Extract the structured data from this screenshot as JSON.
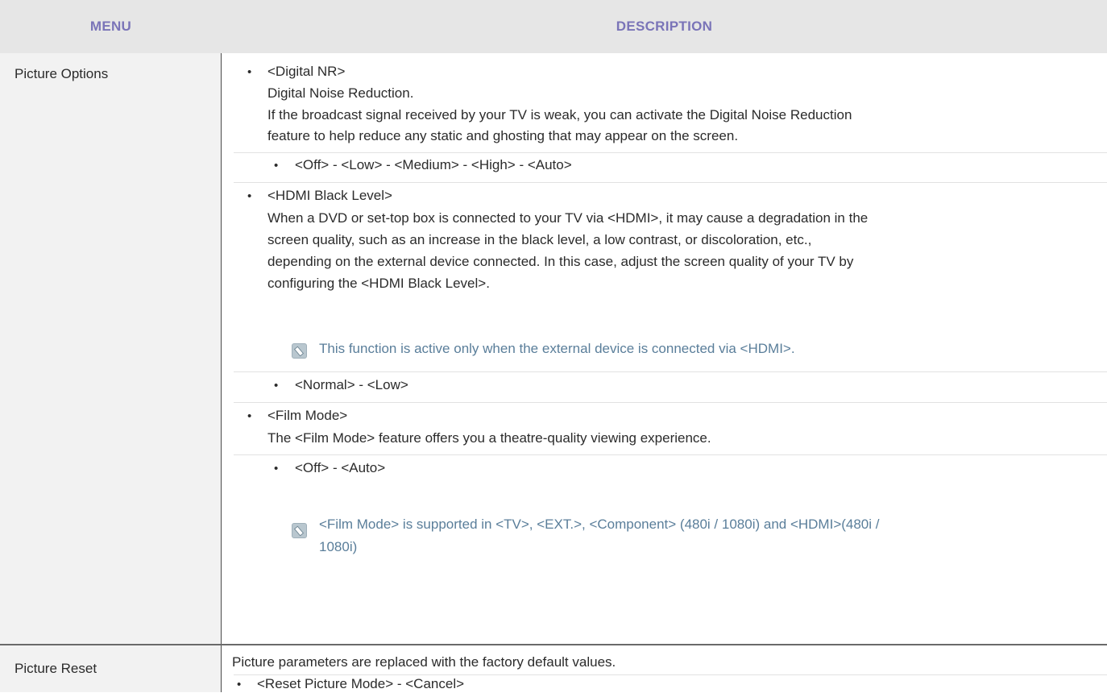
{
  "header": {
    "menu": "MENU",
    "description": "DESCRIPTION"
  },
  "rows": [
    {
      "menu": "Picture Options",
      "items": [
        {
          "title": "<Digital NR>",
          "lines": [
            "Digital Noise Reduction.",
            "If the broadcast signal received by your TV is weak, you can activate the Digital Noise Reduction",
            "feature to help reduce any static and ghosting that may appear on the screen."
          ],
          "sub": "<Off> - <Low> - <Medium> - <High> - <Auto>"
        },
        {
          "title": "<HDMI Black Level>",
          "lines": [
            "When a DVD or set-top box is connected to your TV via <HDMI>, it may cause a degradation in the",
            "screen quality, such as an increase in the black level, a low contrast, or discoloration, etc.,",
            "depending on the external device connected. In this case, adjust the screen quality of your TV by",
            "configuring the <HDMI Black Level>."
          ],
          "note": "This function is active only when the external device is connected via <HDMI>.",
          "sub": "<Normal> - <Low>"
        },
        {
          "title": "<Film Mode>",
          "lines": [
            "The <Film Mode> feature offers you a theatre-quality viewing experience."
          ],
          "sub": "<Off> - <Auto>",
          "note_lines": [
            "<Film Mode> is supported in <TV>, <EXT.>, <Component> (480i / 1080i) and <HDMI>(480i /",
            "1080i)"
          ]
        }
      ]
    },
    {
      "menu": "Picture Reset",
      "text": "Picture parameters are replaced with the factory default values.",
      "sub": "<Reset Picture Mode> - <Cancel>"
    }
  ],
  "bullet_symbol": "•",
  "colors": {
    "header_text": "#7a74b8",
    "note_text": "#5a7e9a",
    "header_bg": "#e6e6e6",
    "menu_bg": "#f2f2f2"
  }
}
